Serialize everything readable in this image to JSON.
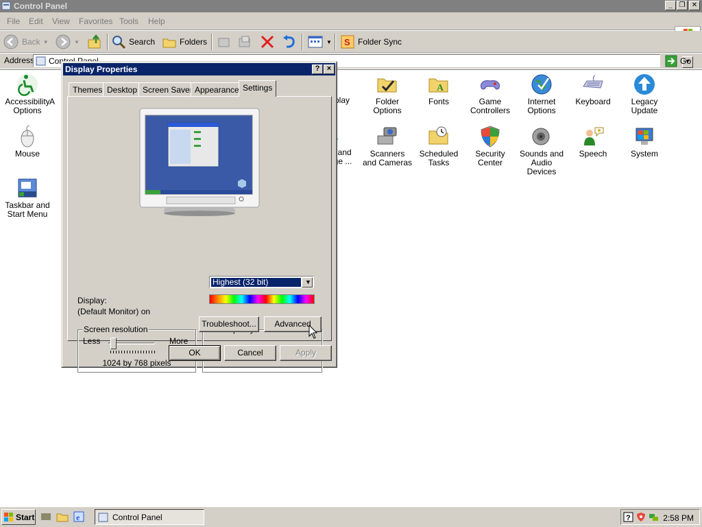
{
  "window": {
    "title": "Control Panel",
    "menus": [
      "File",
      "Edit",
      "View",
      "Favorites",
      "Tools",
      "Help"
    ],
    "toolbar": {
      "back": "Back",
      "search": "Search",
      "folders": "Folders",
      "folder_sync": "Folder Sync"
    },
    "address": {
      "label": "Address",
      "value": "Control Panel",
      "go": "Go"
    }
  },
  "control_panel_items": [
    "Accessibility Options",
    "A",
    "play",
    "Folder Options",
    "Fonts",
    "Game Controllers",
    "Internet Options",
    "Keyboard",
    "Legacy Update",
    "Mouse",
    "al and age ...",
    "Scanners and Cameras",
    "Scheduled Tasks",
    "Security Center",
    "Sounds and Audio Devices",
    "Speech",
    "System",
    "Taskbar and Start Menu"
  ],
  "dialog": {
    "title": "Display Properties",
    "help_button": "?",
    "close_button": "×",
    "tabs": [
      "Themes",
      "Desktop",
      "Screen Saver",
      "Appearance",
      "Settings"
    ],
    "active_tab": "Settings",
    "display_label": "Display:",
    "display_value": "(Default Monitor) on",
    "resolution": {
      "group": "Screen resolution",
      "less": "Less",
      "more": "More",
      "value": "1024 by 768 pixels",
      "slider_position": 0.1
    },
    "color_quality": {
      "group": "Color quality",
      "selected": "Highest (32 bit)"
    },
    "buttons": {
      "troubleshoot": "Troubleshoot...",
      "advanced": "Advanced",
      "ok": "OK",
      "cancel": "Cancel",
      "apply": "Apply"
    }
  },
  "taskbar": {
    "start": "Start",
    "task": "Control Panel",
    "clock": "2:58 PM"
  },
  "colors": {
    "dialog_title": "#0a246a",
    "face": "#d4d0c8",
    "inactive_title": "#808080"
  }
}
